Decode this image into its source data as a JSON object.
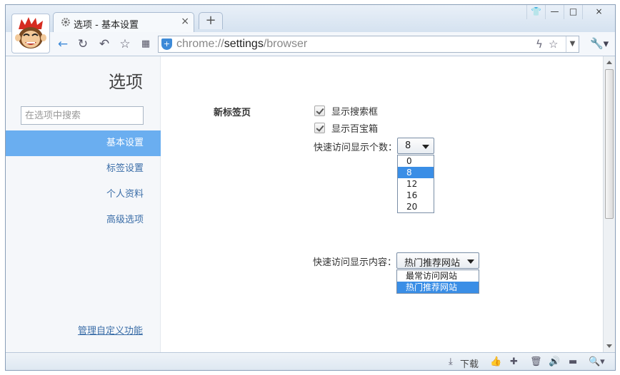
{
  "window": {
    "tab_title": "选项 - 基本设置",
    "tab_close": "×",
    "newtab_label": "+",
    "controls": {
      "skin": "👕",
      "minimize": "—",
      "maximize": "□",
      "close": "×"
    }
  },
  "toolbar": {
    "url_scheme": "chrome://",
    "url_host": "settings",
    "url_path": "/browser",
    "icons": [
      "back-icon",
      "reload-icon",
      "undo-icon",
      "star-icon",
      "apps-icon",
      "lightning-icon",
      "bookmark-star-icon",
      "dropdown-icon",
      "wrench-icon"
    ]
  },
  "sidebar": {
    "title": "选项",
    "search_placeholder": "在选项中搜索",
    "items": [
      {
        "label": "基本设置",
        "active": true
      },
      {
        "label": "标签设置",
        "active": false
      },
      {
        "label": "个人资料",
        "active": false
      },
      {
        "label": "高级选项",
        "active": false
      }
    ],
    "manage_link": "管理自定义功能"
  },
  "main": {
    "section_label": "新标签页",
    "checkboxes": [
      {
        "label": "显示搜索框",
        "checked": true
      },
      {
        "label": "显示百宝箱",
        "checked": true
      }
    ],
    "count_field": {
      "label": "快速访问显示个数：",
      "value": "8",
      "options": [
        "0",
        "8",
        "12",
        "16",
        "20"
      ],
      "selected": "8"
    },
    "content_field": {
      "label": "快速访问显示内容：",
      "value": "热门推荐网站",
      "options": [
        "最常访问网站",
        "热门推荐网站"
      ],
      "selected": "热门推荐网站"
    }
  },
  "statusbar": {
    "download_label": "下载",
    "icons": [
      "download-icon",
      "thumbs-up-icon",
      "medkit-icon",
      "trash-icon",
      "speaker-icon",
      "screen-icon",
      "zoom-icon"
    ]
  },
  "colors": {
    "accent": "#6aaef0",
    "select_highlight": "#3a8ee6",
    "link": "#3b6ea8"
  }
}
